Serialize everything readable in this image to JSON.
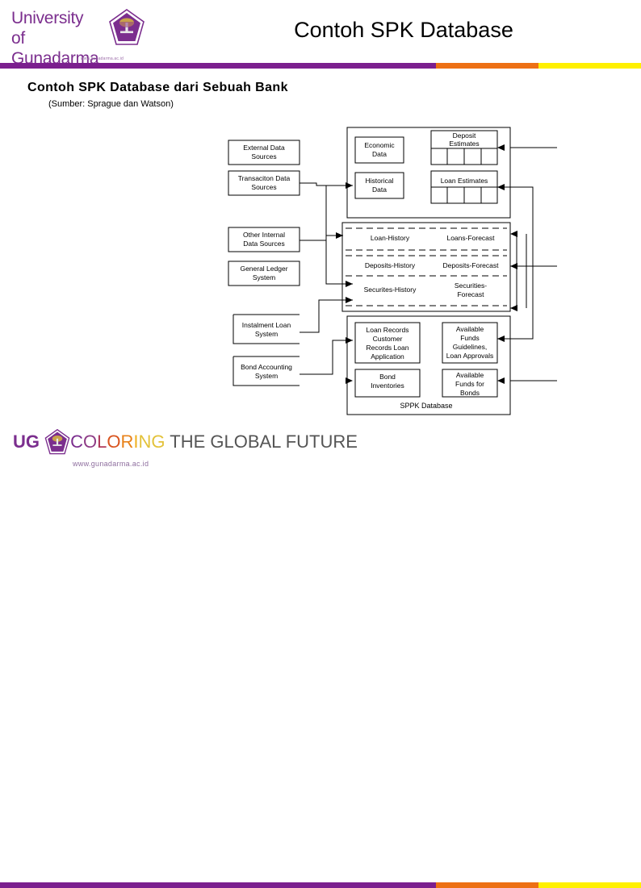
{
  "header": {
    "logo_line1": "University",
    "logo_line2": "of Gunadarma",
    "logo_url": "www.gunadarma.ac.id",
    "logo_mark": "gunadarma-shield-icon",
    "title": "Contoh SPK Database"
  },
  "colors": {
    "purple": "#7B1F8E",
    "orange": "#ED7014",
    "yellow": "#FFF000",
    "line": "#000000",
    "background": "#FFFFFF"
  },
  "divider": {
    "purple_end_pct": 68,
    "orange_end_pct": 84
  },
  "body": {
    "subtitle": "Contoh SPK Database dari Sebuah Bank",
    "source": "(Sumber: Sprague dan Watson)"
  },
  "diagram": {
    "container_label": "SPPK Database",
    "left_sources": [
      {
        "id": "external-data-sources",
        "lines": [
          "External Data",
          "Sources"
        ],
        "open_box": false
      },
      {
        "id": "transaction-data-sources",
        "lines": [
          "Transaciton Data",
          "Sources"
        ],
        "open_box": false
      },
      {
        "id": "other-internal-data-sources",
        "lines": [
          "Other Internal",
          "Data Sources"
        ],
        "open_box": false
      },
      {
        "id": "general-ledger-system",
        "lines": [
          "General Ledger",
          "System"
        ],
        "open_box": false
      },
      {
        "id": "instalment-loan-system",
        "lines": [
          "Instalment Loan",
          "System"
        ],
        "open_box": true
      },
      {
        "id": "bond-accounting-system",
        "lines": [
          "Bond Accounting",
          "System"
        ],
        "open_box": true
      }
    ],
    "top_band": {
      "left_boxes": [
        {
          "id": "economic-data",
          "lines": [
            "Economic",
            "Data"
          ]
        },
        {
          "id": "historical-data",
          "lines": [
            "Historical",
            "Data"
          ]
        }
      ],
      "right_tables": [
        {
          "id": "deposit-estimates",
          "lines": [
            "Deposit",
            "Estimates"
          ],
          "cells": 4
        },
        {
          "id": "loan-estimates",
          "lines": [
            "Loan Estimates"
          ],
          "cells": 4
        }
      ]
    },
    "middle_band": {
      "rows": [
        {
          "id": "loan-history-row",
          "left": "Loan-History",
          "right": "Loans-Forecast"
        },
        {
          "id": "deposits-history-row",
          "left": "Deposits-History",
          "right": "Deposits-Forecast"
        },
        {
          "id": "securities-history-row",
          "left": "Securites-History",
          "right_lines": [
            "Securities-",
            "Forecast"
          ]
        }
      ]
    },
    "bottom_band": {
      "left_boxes": [
        {
          "id": "loan-records",
          "lines": [
            "Loan Records",
            "Customer",
            "Records Loan",
            "Application"
          ]
        },
        {
          "id": "bond-inventories",
          "lines": [
            "Bond",
            "Inventories"
          ]
        }
      ],
      "right_boxes": [
        {
          "id": "available-funds-guidelines",
          "lines": [
            "Available",
            "Funds",
            "Guidelines,",
            "Loan Approvals"
          ]
        },
        {
          "id": "available-funds-bonds",
          "lines": [
            "Available",
            "Funds for",
            "Bonds"
          ]
        }
      ]
    }
  },
  "footer": {
    "ug": "UG",
    "logo_mark": "gunadarma-shield-icon",
    "tagline_parts": [
      "C",
      "O",
      "L",
      "O",
      "R",
      "I",
      "N",
      "G"
    ],
    "tagline_rest": "THE GLOBAL FUTURE",
    "url": "www.gunadarma.ac.id"
  }
}
